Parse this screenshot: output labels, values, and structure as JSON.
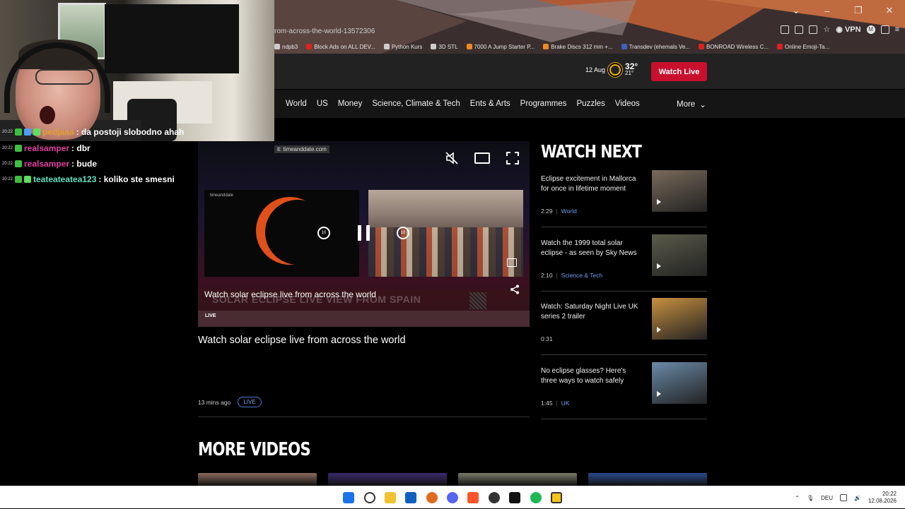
{
  "browser": {
    "url": "rom-across-the-world-13572306",
    "vpn_label": "VPN",
    "profile_initial": "M",
    "bookmarks": [
      {
        "label": "ndpb3",
        "color": "#cccccc"
      },
      {
        "label": "Block Ads on ALL DEV...",
        "color": "#e02020"
      },
      {
        "label": "Python Kurs",
        "color": "#cccccc"
      },
      {
        "label": "3D STL",
        "color": "#cccccc"
      },
      {
        "label": "7000 A Jump Starter P...",
        "color": "#f08a20"
      },
      {
        "label": "Brake Discs 312 mm +...",
        "color": "#f08a20"
      },
      {
        "label": "Transdev (ehemals Ve...",
        "color": "#4060c0"
      },
      {
        "label": "BONROAD Wireless C...",
        "color": "#e02020"
      },
      {
        "label": "Online Emoji-Ta...",
        "color": "#e02020"
      }
    ]
  },
  "header": {
    "date": "12 Aug",
    "temp_high": "32°",
    "temp_low": "21°",
    "watch_live_label": "Watch Live"
  },
  "nav": {
    "items": [
      "World",
      "US",
      "Money",
      "Science, Climate & Tech",
      "Ents & Arts",
      "Programmes",
      "Puzzles",
      "Videos"
    ],
    "more_label": "More"
  },
  "video": {
    "credit": "it: timeanddate.com",
    "brand": "timeanddate",
    "caption": "Watch solar eclipse live from across the world",
    "lower_band": "SOLAR ECLIPSE    LIVE VIEW FROM SPAIN",
    "ticker_live": "LIVE",
    "rewind_label": "10",
    "forward_label": "10"
  },
  "main_story": {
    "title": "Watch solar eclipse live from across the world",
    "time": "13 mins ago",
    "badge": "LIVE"
  },
  "watch_next": {
    "heading": "WATCH NEXT",
    "items": [
      {
        "title": "Eclipse excitement in Mallorca for once in lifetime moment",
        "duration": "2:29",
        "category": "World",
        "thumb_color": "#7a6a5a"
      },
      {
        "title": "Watch the 1999 total solar eclipse - as seen by Sky News",
        "duration": "2:10",
        "category": "Science & Tech",
        "thumb_color": "#5a5a4a"
      },
      {
        "title": "Watch: Saturday Night Live UK series 2 trailer",
        "duration": "0:31",
        "category": "",
        "thumb_color": "#c89040"
      },
      {
        "title": "No eclipse glasses? Here's three ways to watch safely",
        "duration": "1:45",
        "category": "UK",
        "thumb_color": "#6a8aa8"
      }
    ]
  },
  "more_videos": {
    "heading": "MORE VIDEOS",
    "thumb_colors": [
      "#8a6a5a",
      "#3a2a6a",
      "#7a7a6a",
      "#2a4a8a"
    ]
  },
  "stream": {
    "chat": [
      {
        "time": "20:22",
        "user": "pedjaaa",
        "user_color": "#e0a030",
        "message": ": da postoji slobodno ahah",
        "badges": [
          "#3fbf3f",
          "#4aa0ff",
          "#5fdf5f"
        ]
      },
      {
        "time": "20:22",
        "user": "realsamper",
        "user_color": "#e040a0",
        "message": ": dbr",
        "badges": [
          "#3fbf3f"
        ]
      },
      {
        "time": "20:22",
        "user": "realsamper",
        "user_color": "#e040a0",
        "message": ": bude",
        "badges": [
          "#3fbf3f"
        ]
      },
      {
        "time": "20:22",
        "user": "teateateatea123",
        "user_color": "#60e0c0",
        "message": ": koliko ste smesni",
        "badges": [
          "#3fbf3f",
          "#5fdf5f"
        ]
      }
    ]
  },
  "taskbar": {
    "language": "DEU",
    "time": "20:22",
    "date": "12.08.2026"
  }
}
